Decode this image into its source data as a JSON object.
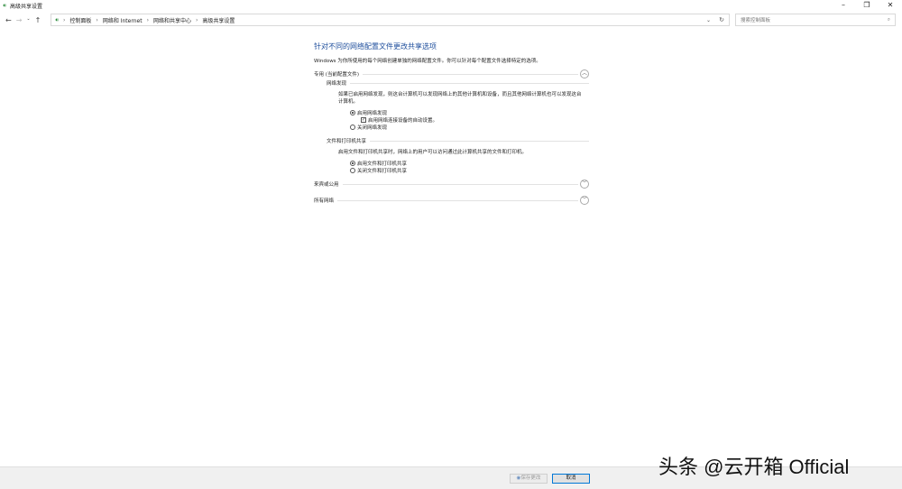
{
  "window": {
    "title": "高级共享设置",
    "minimize": "–",
    "restore": "❐",
    "close": "✕"
  },
  "address": {
    "breadcrumbs": [
      "控制面板",
      "网络和 Internet",
      "网络和共享中心",
      "高级共享设置"
    ],
    "search_placeholder": "搜索控制面板"
  },
  "main": {
    "title": "针对不同的网络配置文件更改共享选项",
    "description": "Windows 为你所使用的每个网络创建单独的网络配置文件。你可以针对每个配置文件选择特定的选项。",
    "profile_private": "专用 (当前配置文件)",
    "discovery": {
      "heading": "网络发现",
      "text": "如果已启用网络发现，则这台计算机可以发现网络上的其他计算机和设备，而且其他网络计算机也可以发现这台计算机。",
      "on": "启用网络发现",
      "auto": "启用网络连接设备的自动设置。",
      "off": "关闭网络发现"
    },
    "sharing": {
      "heading": "文件和打印机共享",
      "text": "启用文件和打印机共享时，网络上的用户可以访问通过此计算机共享的文件和打印机。",
      "on": "启用文件和打印机共享",
      "off": "关闭文件和打印机共享"
    },
    "profile_guest": "来宾或公用",
    "profile_all": "所有网络"
  },
  "footer": {
    "save": "保存更改",
    "cancel": "取消"
  },
  "watermark": "头条 @云开箱 Official"
}
